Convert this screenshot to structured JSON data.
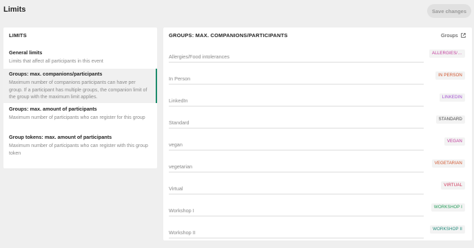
{
  "header": {
    "title": "Limits",
    "save_label": "Save changes"
  },
  "left_panel": {
    "heading": "LIMITS",
    "items": [
      {
        "title": "General limits",
        "description": "Limits that affect all participants in this event"
      },
      {
        "title": "Groups: max. companions/participants",
        "description": "Maximum number of companions participants can have per group. If a participant has multiple groups, the companion limit of the group with the maximum limit applies."
      },
      {
        "title": "Groups: max. amount of participants",
        "description": "Maximum number of participants who can register for this group"
      },
      {
        "title": "Group tokens: max. amount of participants",
        "description": "Maximum number of participants who can register with this group token"
      }
    ]
  },
  "right_panel": {
    "heading": "GROUPS: MAX. COMPANIONS/PARTICIPANTS",
    "groups_link": "Groups",
    "groups": [
      {
        "name": "Allergies/Food intolerances",
        "badge": "ALLERGIES/F...",
        "color": "#c0399b"
      },
      {
        "name": "In Person",
        "badge": "IN PERSON",
        "color": "#d0532b"
      },
      {
        "name": "LinkedIn",
        "badge": "LINKEDIN",
        "color": "#a24fd0"
      },
      {
        "name": "Standard",
        "badge": "STANDARD",
        "color": "#444444"
      },
      {
        "name": "vegan",
        "badge": "VEGAN",
        "color": "#c0399b"
      },
      {
        "name": "vegetarian",
        "badge": "VEGETARIAN",
        "color": "#d0532b"
      },
      {
        "name": "Virtual",
        "badge": "VIRTUAL",
        "color": "#cf2f55"
      },
      {
        "name": "Workshop I",
        "badge": "WORKSHOP I",
        "color": "#1e9a55"
      },
      {
        "name": "Workshop II",
        "badge": "WORKSHOP II",
        "color": "#1e8a7a"
      }
    ]
  }
}
